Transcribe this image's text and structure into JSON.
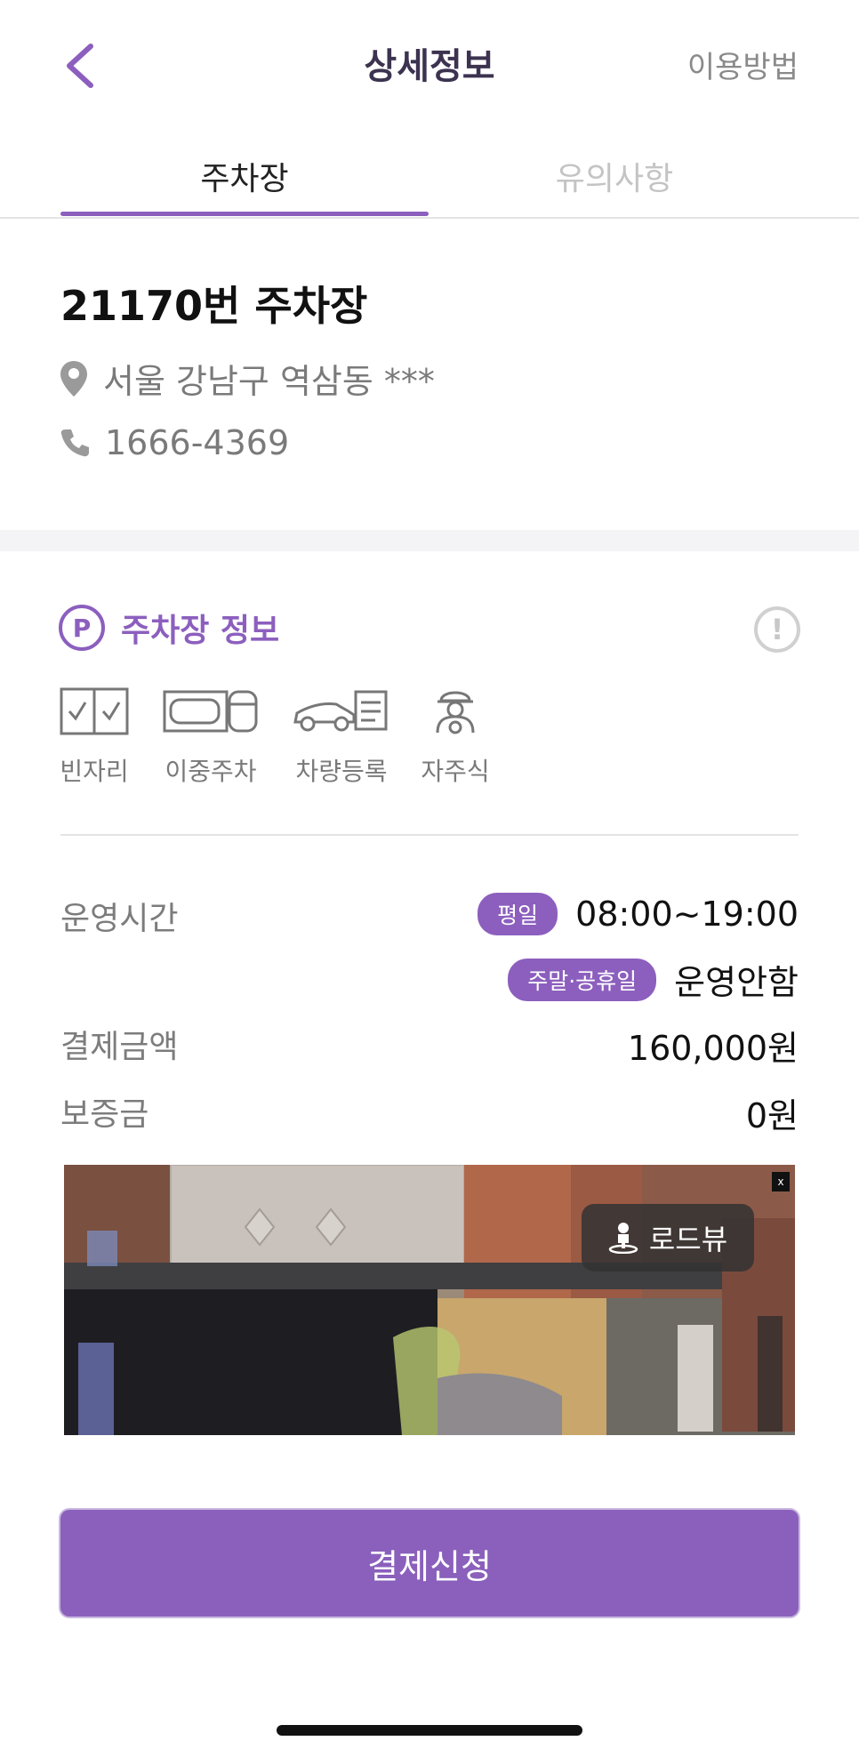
{
  "header": {
    "title": "상세정보",
    "howto_label": "이용방법",
    "back_icon": "chevron-left-icon"
  },
  "tabs": [
    {
      "label": "주차장",
      "active": true
    },
    {
      "label": "유의사항",
      "active": false
    }
  ],
  "lot": {
    "name": "21170번 주차장",
    "address": "서울 강남구 역삼동 ***",
    "phone": "1666-4369"
  },
  "section": {
    "badge_letter": "P",
    "title": "주차장 정보",
    "info_glyph": "!"
  },
  "features": [
    {
      "label": "빈자리",
      "icon": "vacancy-icon"
    },
    {
      "label": "이중주차",
      "icon": "double-parking-icon"
    },
    {
      "label": "차량등록",
      "icon": "car-registration-icon"
    },
    {
      "label": "자주식",
      "icon": "self-parking-icon"
    }
  ],
  "details": {
    "hours_label": "운영시간",
    "weekday_badge": "평일",
    "weekday_hours": "08:00~19:00",
    "weekend_badge": "주말·공휴일",
    "weekend_hours": "운영안함",
    "price_label": "결제금액",
    "price_value": "160,000원",
    "deposit_label": "보증금",
    "deposit_value": "0원"
  },
  "roadview": {
    "button_label": "로드뷰",
    "close_glyph": "x"
  },
  "pay_button_label": "결제신청",
  "colors": {
    "accent": "#8c5fbe",
    "title": "#3c3350",
    "muted": "#7a7a7a"
  }
}
